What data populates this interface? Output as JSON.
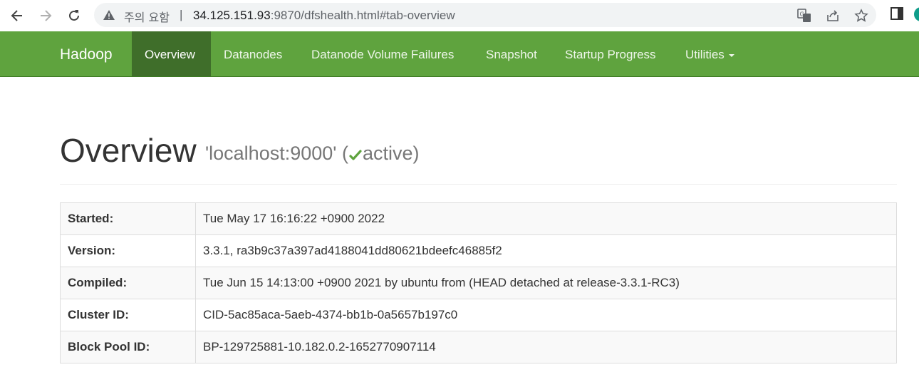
{
  "browser": {
    "security_label": "주의 요함",
    "separator": "|",
    "url_host": "34.125.151.93",
    "url_rest": ":9870/dfshealth.html#tab-overview"
  },
  "navbar": {
    "brand": "Hadoop",
    "items": [
      {
        "label": "Overview"
      },
      {
        "label": "Datanodes"
      },
      {
        "label": "Datanode Volume Failures"
      },
      {
        "label": "Snapshot"
      },
      {
        "label": "Startup Progress"
      },
      {
        "label": "Utilities"
      }
    ]
  },
  "header": {
    "title": "Overview",
    "host": "'localhost:9000'",
    "status_open": "(",
    "status": "active",
    "status_close": ")"
  },
  "info_rows": [
    {
      "key": "Started:",
      "value": "Tue May 17 16:16:22 +0900 2022"
    },
    {
      "key": "Version:",
      "value": "3.3.1, ra3b9c37a397ad4188041dd80621bdeefc46885f2"
    },
    {
      "key": "Compiled:",
      "value": "Tue Jun 15 14:13:00 +0900 2021 by ubuntu from (HEAD detached at release-3.3.1-RC3)"
    },
    {
      "key": "Cluster ID:",
      "value": "CID-5ac85aca-5aeb-4374-bb1b-0a5657b197c0"
    },
    {
      "key": "Block Pool ID:",
      "value": "BP-129725881-10.182.0.2-1652770907114"
    }
  ],
  "colors": {
    "navbar": "#5fa33e",
    "navbar_active": "#3f6e2a",
    "check": "#5fa33e"
  }
}
